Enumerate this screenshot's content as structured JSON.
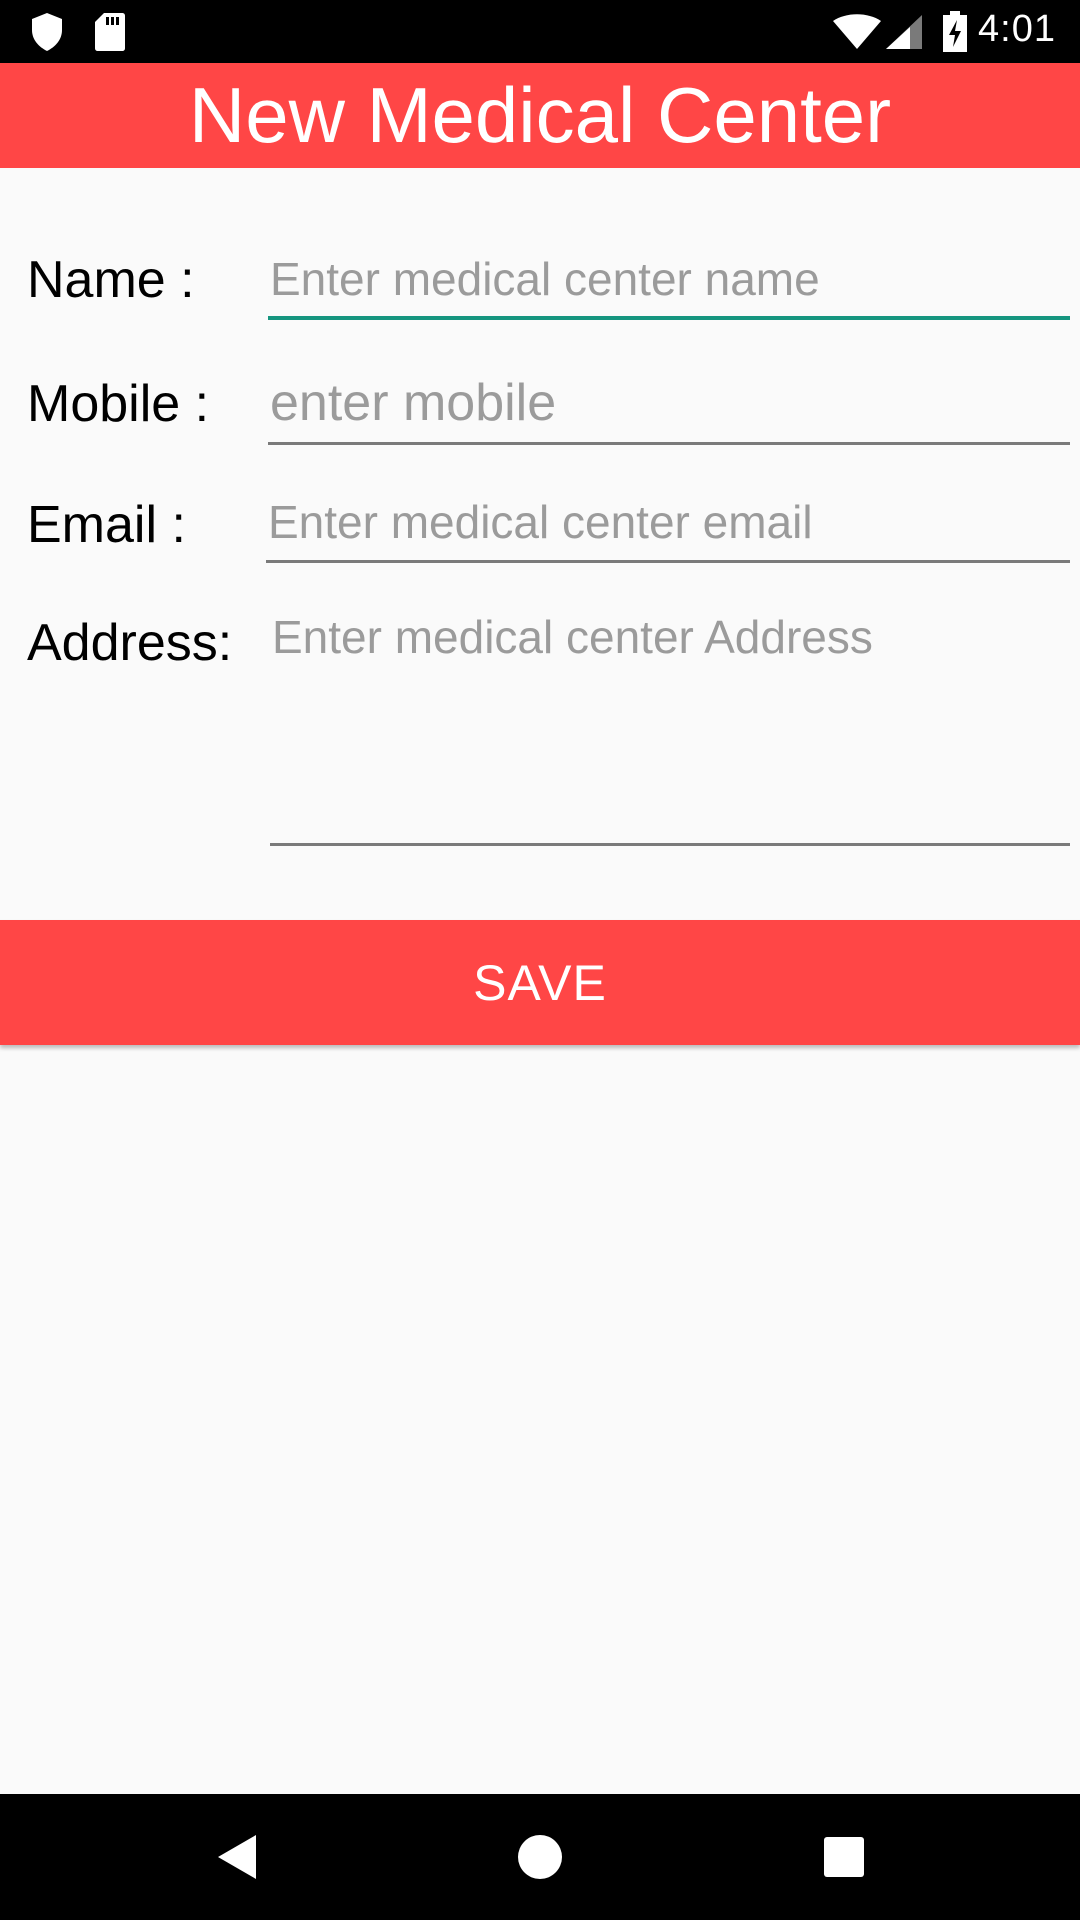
{
  "status_bar": {
    "time": "4:01",
    "icons": [
      "shield-icon",
      "sd-card-icon",
      "wifi-icon",
      "cell-signal-icon",
      "battery-charging-icon"
    ]
  },
  "app_bar": {
    "title": "New Medical Center"
  },
  "form": {
    "name": {
      "label": "Name :",
      "value": "",
      "placeholder": "Enter medical center name",
      "focused": true
    },
    "mobile": {
      "label": "Mobile :",
      "value": "",
      "placeholder": "enter mobile"
    },
    "email": {
      "label": "Email :",
      "value": "",
      "placeholder": "Enter medical center email"
    },
    "address": {
      "label": "Address:",
      "value": "",
      "placeholder": "Enter medical center Address"
    }
  },
  "save_button": {
    "label": "SAVE"
  },
  "nav_bar": {
    "buttons": [
      "back-icon",
      "home-icon",
      "recents-icon"
    ]
  },
  "colors": {
    "accent": "#ff4646",
    "focus_underline": "#15957f",
    "placeholder": "#9b9b9b"
  }
}
